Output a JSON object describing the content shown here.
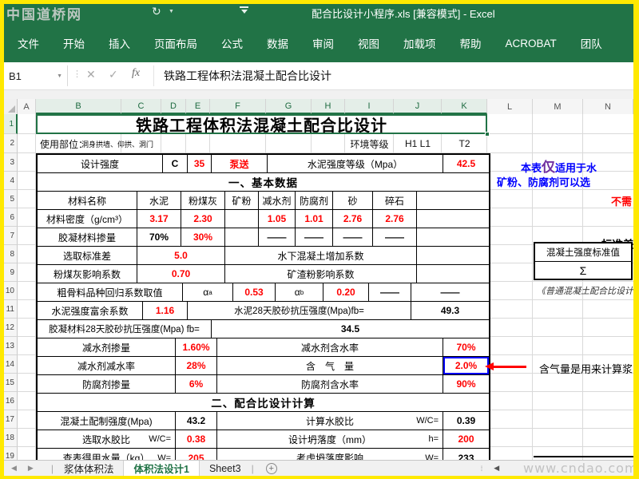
{
  "window": {
    "title": "配合比设计小程序.xls [兼容模式] - Excel",
    "watermark_top": "中国道桥网",
    "watermark_bottom": "www.cndao.com"
  },
  "ribbon": {
    "tabs": [
      "文件",
      "开始",
      "插入",
      "页面布局",
      "公式",
      "数据",
      "审阅",
      "视图",
      "加载项",
      "帮助",
      "ACROBAT",
      "团队"
    ]
  },
  "formula_bar": {
    "cell_ref": "B1",
    "fx_label": "fx",
    "formula": "铁路工程体积法混凝土配合比设计"
  },
  "grid": {
    "columns": [
      "A",
      "B",
      "C",
      "D",
      "E",
      "F",
      "G",
      "H",
      "I",
      "J",
      "K",
      "L",
      "M",
      "N"
    ],
    "row_numbers": [
      "1",
      "2",
      "3",
      "4",
      "5",
      "6",
      "7",
      "8",
      "9",
      "10",
      "11",
      "12",
      "13",
      "14",
      "15",
      "16",
      "17",
      "18",
      "19"
    ]
  },
  "cells": {
    "title": "铁路工程体积法混凝土配合比设计",
    "usage_label": "使用部位：",
    "usage_value": "洞身拱墙、仰拱、洞门",
    "env_label": "环境等级",
    "env_value1": "H1 L1",
    "env_value2": "T2"
  },
  "table": {
    "r3": {
      "c1": "设计强度",
      "c2": "C",
      "c3": "35",
      "c4": "泵送",
      "c5": "水泥强度等级（Mpa）",
      "c6": "42.5"
    },
    "r4": {
      "header": "一、基本数据"
    },
    "r5": {
      "c1": "材料名称",
      "c2": "水泥",
      "c3": "粉煤灰",
      "c4": "矿粉",
      "c5": "减水剂",
      "c6": "防腐剂",
      "c7": "砂",
      "c8": "碎石"
    },
    "r6": {
      "c1": "材料密度（g/cm³）",
      "c2": "3.17",
      "c3": "2.30",
      "c4": "",
      "c5": "1.05",
      "c6": "1.01",
      "c7": "2.76",
      "c8": "2.76"
    },
    "r7": {
      "c1": "胶凝材料掺量",
      "c2": "70%",
      "c3": "30%",
      "c4": "",
      "c5": "——",
      "c6": "——",
      "c7": "——",
      "c8": "——"
    },
    "r8": {
      "c1": "选取标准差",
      "c2": "5.0",
      "c3": "水下混凝土增加系数",
      "c4": ""
    },
    "r9": {
      "c1": "粉煤灰影响系数",
      "c2": "0.70",
      "c3": "矿渣粉影响系数",
      "c4": ""
    },
    "r10": {
      "c1": "粗骨料品种回归系数取值",
      "a1": "α",
      "a1s": "a",
      "c2": "0.53",
      "a2": "α",
      "a2s": "b",
      "c3": "0.20",
      "c4": "——",
      "c5": "——"
    },
    "r11": {
      "c1": "水泥强度富余系数",
      "c2": "1.16",
      "c3": "水泥28天胶砂抗压强度(Mpa)fb=",
      "c4": "49.3"
    },
    "r12": {
      "c1": "胶凝材料28天胶砂抗压强度(Mpa) fb=",
      "c2": "34.5"
    },
    "r13": {
      "c1": "减水剂掺量",
      "c2": "1.60%",
      "c3": "减水剂含水率",
      "c4": "70%"
    },
    "r14": {
      "c1": "减水剂减水率",
      "c2": "28%",
      "c3": "含　气　量",
      "c4": "2.0%"
    },
    "r15": {
      "c1": "防腐剂掺量",
      "c2": "6%",
      "c3": "防腐剂含水率",
      "c4": "90%"
    },
    "r16": {
      "header": "二、配合比设计计算"
    },
    "r17": {
      "c1": "混凝土配制强度(Mpa)",
      "c2": "43.2",
      "c3": "计算水胶比",
      "c3s": "W/C=",
      "c4": "0.39"
    },
    "r18": {
      "c1": "选取水胶比",
      "c1s": "W/C=",
      "c2": "0.38",
      "c3": "设计坍落度（mm）",
      "c3s": "h=",
      "c4": "200"
    },
    "r19": {
      "c1": "查表得用水量（kg）",
      "c1s": "W=",
      "c2": "205",
      "c3": "考虑坍落度影响",
      "c3s": "W=",
      "c4": "233"
    }
  },
  "notes": {
    "blue1_pre": "本表",
    "blue1_em": "仅",
    "blue1_post": "适用于水",
    "blue2": "矿粉、防腐剂可以选",
    "red1": "不需",
    "std_label": "标准差",
    "box_title": "混凝土强度标准值",
    "box_sigma": "Σ",
    "reference": "《普通混凝土配合比设计",
    "air_note": "含气量是用来计算浆"
  },
  "sheet_tabs": {
    "nav_left": "◀",
    "nav_right": "▶",
    "tabs": [
      "浆体体积法",
      "体积法设计1",
      "Sheet3"
    ],
    "active": "体积法设计1",
    "add_label": "+"
  },
  "colors": {
    "excel_green": "#217346",
    "frame_yellow": "#ffe900",
    "value_red": "#ff0000",
    "note_blue": "#0000ff",
    "emphasis_purple": "#7030a0",
    "highlight_cell_border": "#0000ff"
  }
}
